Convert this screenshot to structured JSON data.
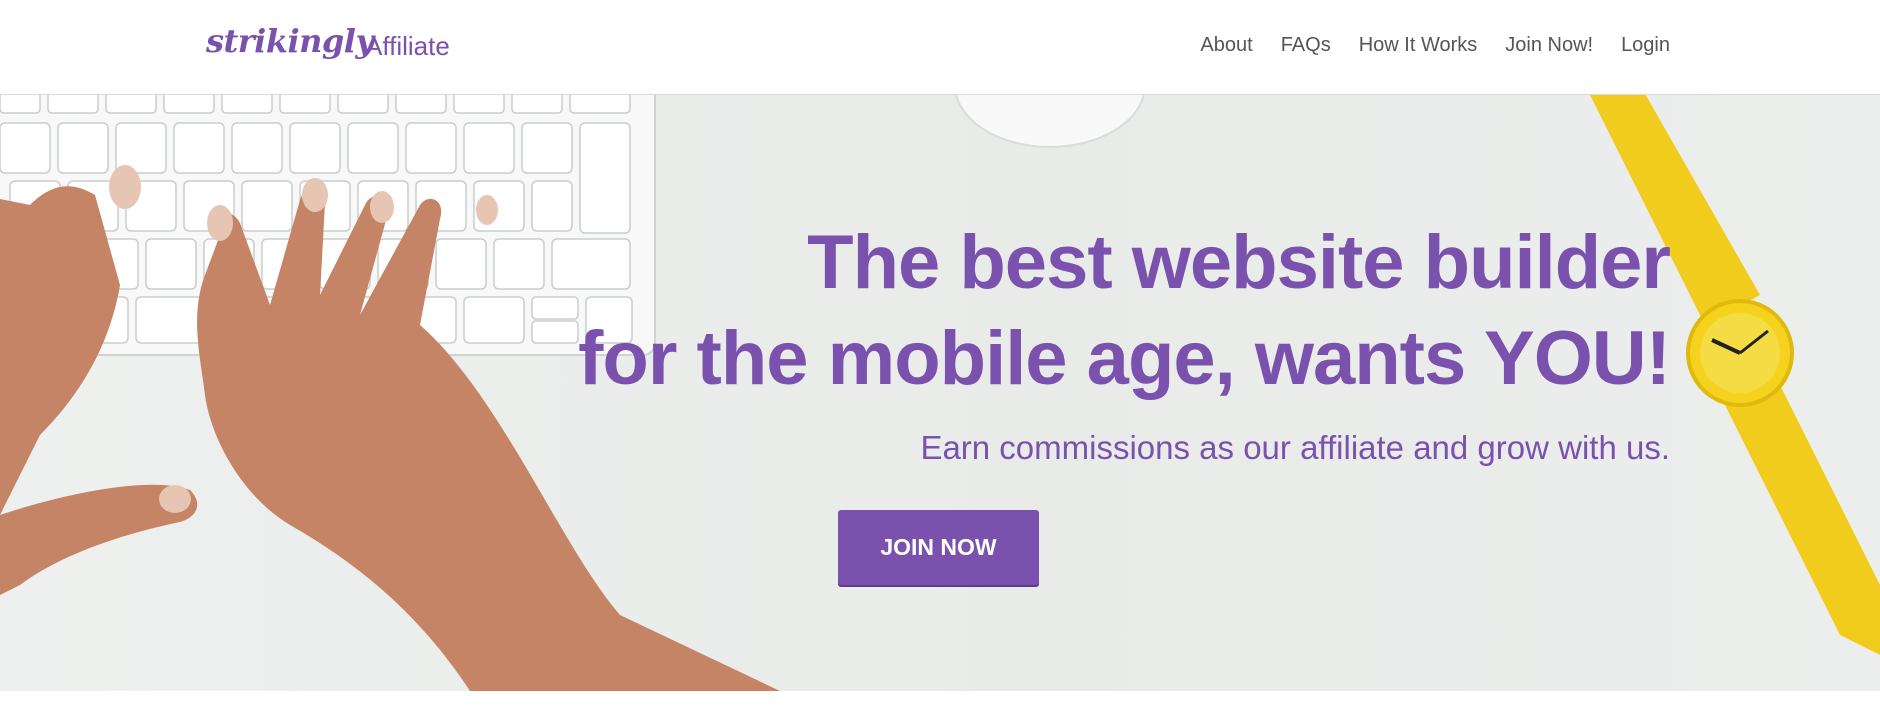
{
  "header": {
    "logo_text": "strikingly",
    "logo_suffix": "Affiliate",
    "nav": [
      {
        "label": "About"
      },
      {
        "label": "FAQs"
      },
      {
        "label": "How It Works"
      },
      {
        "label": "Join Now!"
      },
      {
        "label": "Login"
      }
    ]
  },
  "hero": {
    "headline_line1": "The best website builder",
    "headline_line2": "for the mobile age, wants YOU!",
    "subheadline": "Earn commissions as our affiliate and grow with us.",
    "cta_label": "JOIN NOW",
    "background_image": "hands typing on keyboard with mouse and yellow watch on desk"
  },
  "colors": {
    "brand": "#7a52ae",
    "nav_text": "#555555",
    "background": "#ffffff",
    "hero_bg": "#eceeed"
  }
}
